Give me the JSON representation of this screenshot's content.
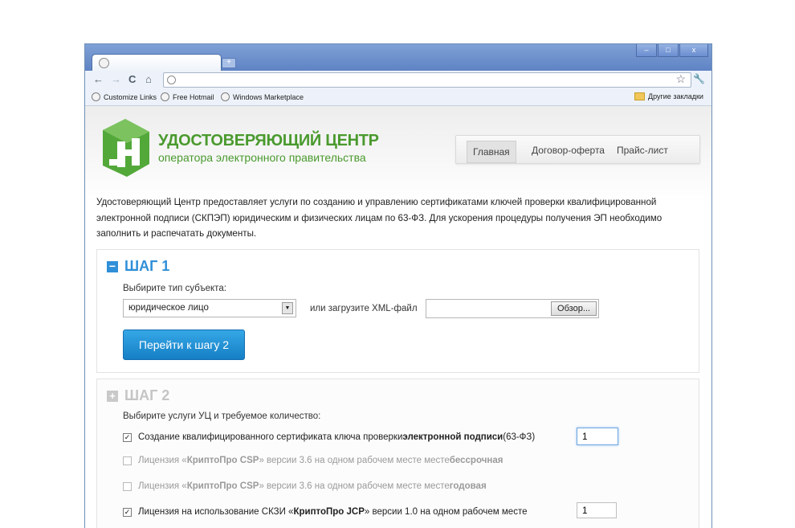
{
  "browser": {
    "window_controls": {
      "minimize": "–",
      "maximize": "□",
      "close": "x"
    },
    "new_tab_label": "+",
    "nav": {
      "back": "←",
      "forward": "→",
      "reload": "C",
      "home": "⌂"
    },
    "address_value": "",
    "bookmarks": [
      {
        "label": "Customize Links",
        "icon": "globe-icon"
      },
      {
        "label": "Free Hotmail",
        "icon": "globe-icon"
      },
      {
        "label": "Windows Marketplace",
        "icon": "globe-icon"
      }
    ],
    "other_bookmarks": "Другие закладки"
  },
  "header": {
    "logo_title": "УДОСТОВЕРЯЮЩИЙ ЦЕНТР",
    "logo_subtitle": "оператора электронного правительства",
    "menu": [
      {
        "label": "Главная",
        "active": true
      },
      {
        "label": "Договор-оферта",
        "active": false
      },
      {
        "label": "Прайс-лист",
        "active": false
      }
    ]
  },
  "intro_text": "Удостоверяющий Центр предоставляет услуги  по созданию и управлению сертификатами ключей  проверки квалифицированной электронной подписи (СКПЭП) юридическим и физических лицам по 63-ФЗ. Для ускорения процедуры получения ЭП необходимо заполнить и распечатать документы.",
  "step1": {
    "toggle": "−",
    "title": "ШАГ 1",
    "subject_label": "Выбирите тип субъекта:",
    "subject_value": "юридическое лицо",
    "xml_label": "или загрузите XML-файл",
    "file_value": "",
    "browse_label": "Обзор...",
    "next_button": "Перейти к шагу 2"
  },
  "step2": {
    "toggle": "+",
    "title": "ШАГ 2",
    "services_label": "Выбирите услуги УЦ и требуемое количество:",
    "services": [
      {
        "checked": true,
        "enabled": true,
        "parts": [
          "Создание квалифицированного сертификата ключа проверки ",
          "электронной подписи",
          " (63-ФЗ)"
        ],
        "quantity": "1"
      },
      {
        "checked": false,
        "enabled": false,
        "parts": [
          "Лицензия  «",
          "КриптоПро CSP",
          "» версии 3.6 на одном рабочем месте месте ",
          "бессрочная"
        ],
        "quantity": ""
      },
      {
        "checked": false,
        "enabled": false,
        "parts": [
          "Лицензия  «",
          "КриптоПро CSP",
          "» версии 3.6 на одном рабочем месте месте ",
          "годовая"
        ],
        "quantity": ""
      },
      {
        "checked": true,
        "enabled": true,
        "parts": [
          "Лицензия на использование СКЗИ «",
          "КриптоПро JCP",
          "» версии 1.0 на одном рабочем месте"
        ],
        "quantity": "1"
      }
    ]
  }
}
